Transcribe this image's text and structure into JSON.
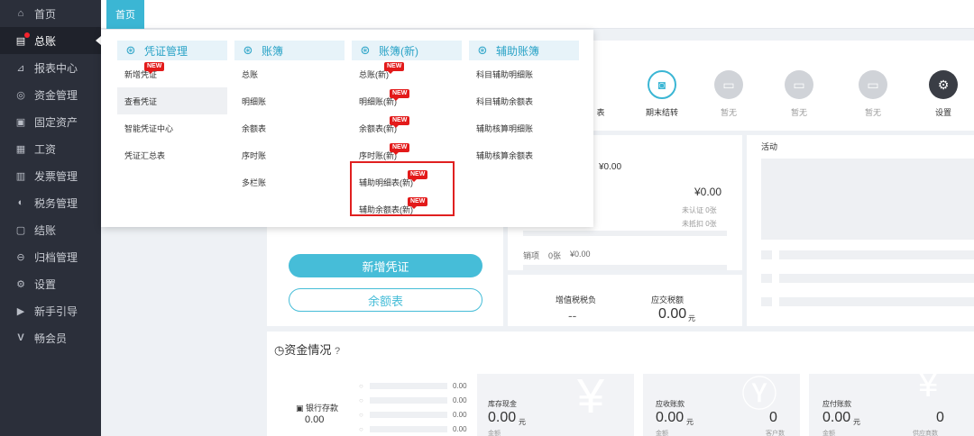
{
  "sidebar": {
    "items": [
      {
        "label": "首页",
        "icon": "home-icon"
      },
      {
        "label": "总账",
        "icon": "ledger-icon"
      },
      {
        "label": "报表中心",
        "icon": "chart-icon"
      },
      {
        "label": "资金管理",
        "icon": "money-icon"
      },
      {
        "label": "固定资产",
        "icon": "asset-icon"
      },
      {
        "label": "工资",
        "icon": "salary-icon"
      },
      {
        "label": "发票管理",
        "icon": "invoice-icon"
      },
      {
        "label": "税务管理",
        "icon": "tax-icon"
      },
      {
        "label": "结账",
        "icon": "closing-icon"
      },
      {
        "label": "归档管理",
        "icon": "archive-icon"
      },
      {
        "label": "设置",
        "icon": "gear-icon"
      },
      {
        "label": "新手引导",
        "icon": "guide-icon"
      },
      {
        "label": "畅会员",
        "icon": "vip-icon"
      }
    ]
  },
  "tabs": [
    {
      "label": "首页"
    }
  ],
  "menu": {
    "voucher": {
      "title": "凭证管理",
      "items": [
        "新增凭证",
        "查看凭证",
        "智能凭证中心",
        "凭证汇总表"
      ]
    },
    "books": {
      "title": "账簿",
      "items": [
        "总账",
        "明细账",
        "余额表",
        "序时账",
        "多栏账"
      ]
    },
    "books_new": {
      "title": "账簿(新)",
      "items": [
        "总账(新)",
        "明细账(新)",
        "余额表(新)",
        "序时账(新)",
        "辅助明细表(新)",
        "辅助余额表(新)"
      ]
    },
    "aux": {
      "title": "辅助账簿",
      "items": [
        "科目辅助明细账",
        "科目辅助余额表",
        "辅助核算明细账",
        "辅助核算余额表"
      ]
    },
    "new_badge": "NEW"
  },
  "quick": {
    "items": [
      {
        "label": "表",
        "icon": "report-icon"
      },
      {
        "label": "期末结转",
        "icon": "period-close-icon"
      },
      {
        "label": "暂无",
        "icon": "empty-icon"
      },
      {
        "label": "暂无",
        "icon": "empty-icon"
      },
      {
        "label": "暂无",
        "icon": "empty-icon"
      },
      {
        "label": "设置",
        "icon": "gear-icon"
      }
    ]
  },
  "invoice": {
    "amount1": "¥0.00",
    "amount2": "¥0.00",
    "unverified": "未认证 0张",
    "undeducted": "未抵扣 0张",
    "output_label": "销项",
    "output_count": "0张",
    "output_amount": "¥0.00"
  },
  "tax": {
    "vat_label": "增值税税负",
    "vat_value": "--",
    "due_label": "应交税额",
    "due_value": "0.00",
    "due_unit": "元"
  },
  "activity": {
    "title": "活动"
  },
  "buttons": {
    "new_voucher": "新增凭证",
    "balance": "余额表"
  },
  "funds": {
    "title": "资金情况",
    "bank_label": "银行存款",
    "bank_value": "0.00",
    "bars": [
      "0.00",
      "0.00",
      "0.00",
      "0.00"
    ],
    "cash_label": "库存现金",
    "cash_value": "0.00",
    "cash_unit": "元",
    "recv_label": "应收账款",
    "recv_value": "0.00",
    "recv_unit": "元",
    "recv_count": "0",
    "pay_label": "应付账款",
    "pay_value": "0.00",
    "pay_unit": "元",
    "pay_count": "0",
    "sub_amount": "金额",
    "sub_customers": "客户数",
    "sub_suppliers": "供应商数"
  }
}
